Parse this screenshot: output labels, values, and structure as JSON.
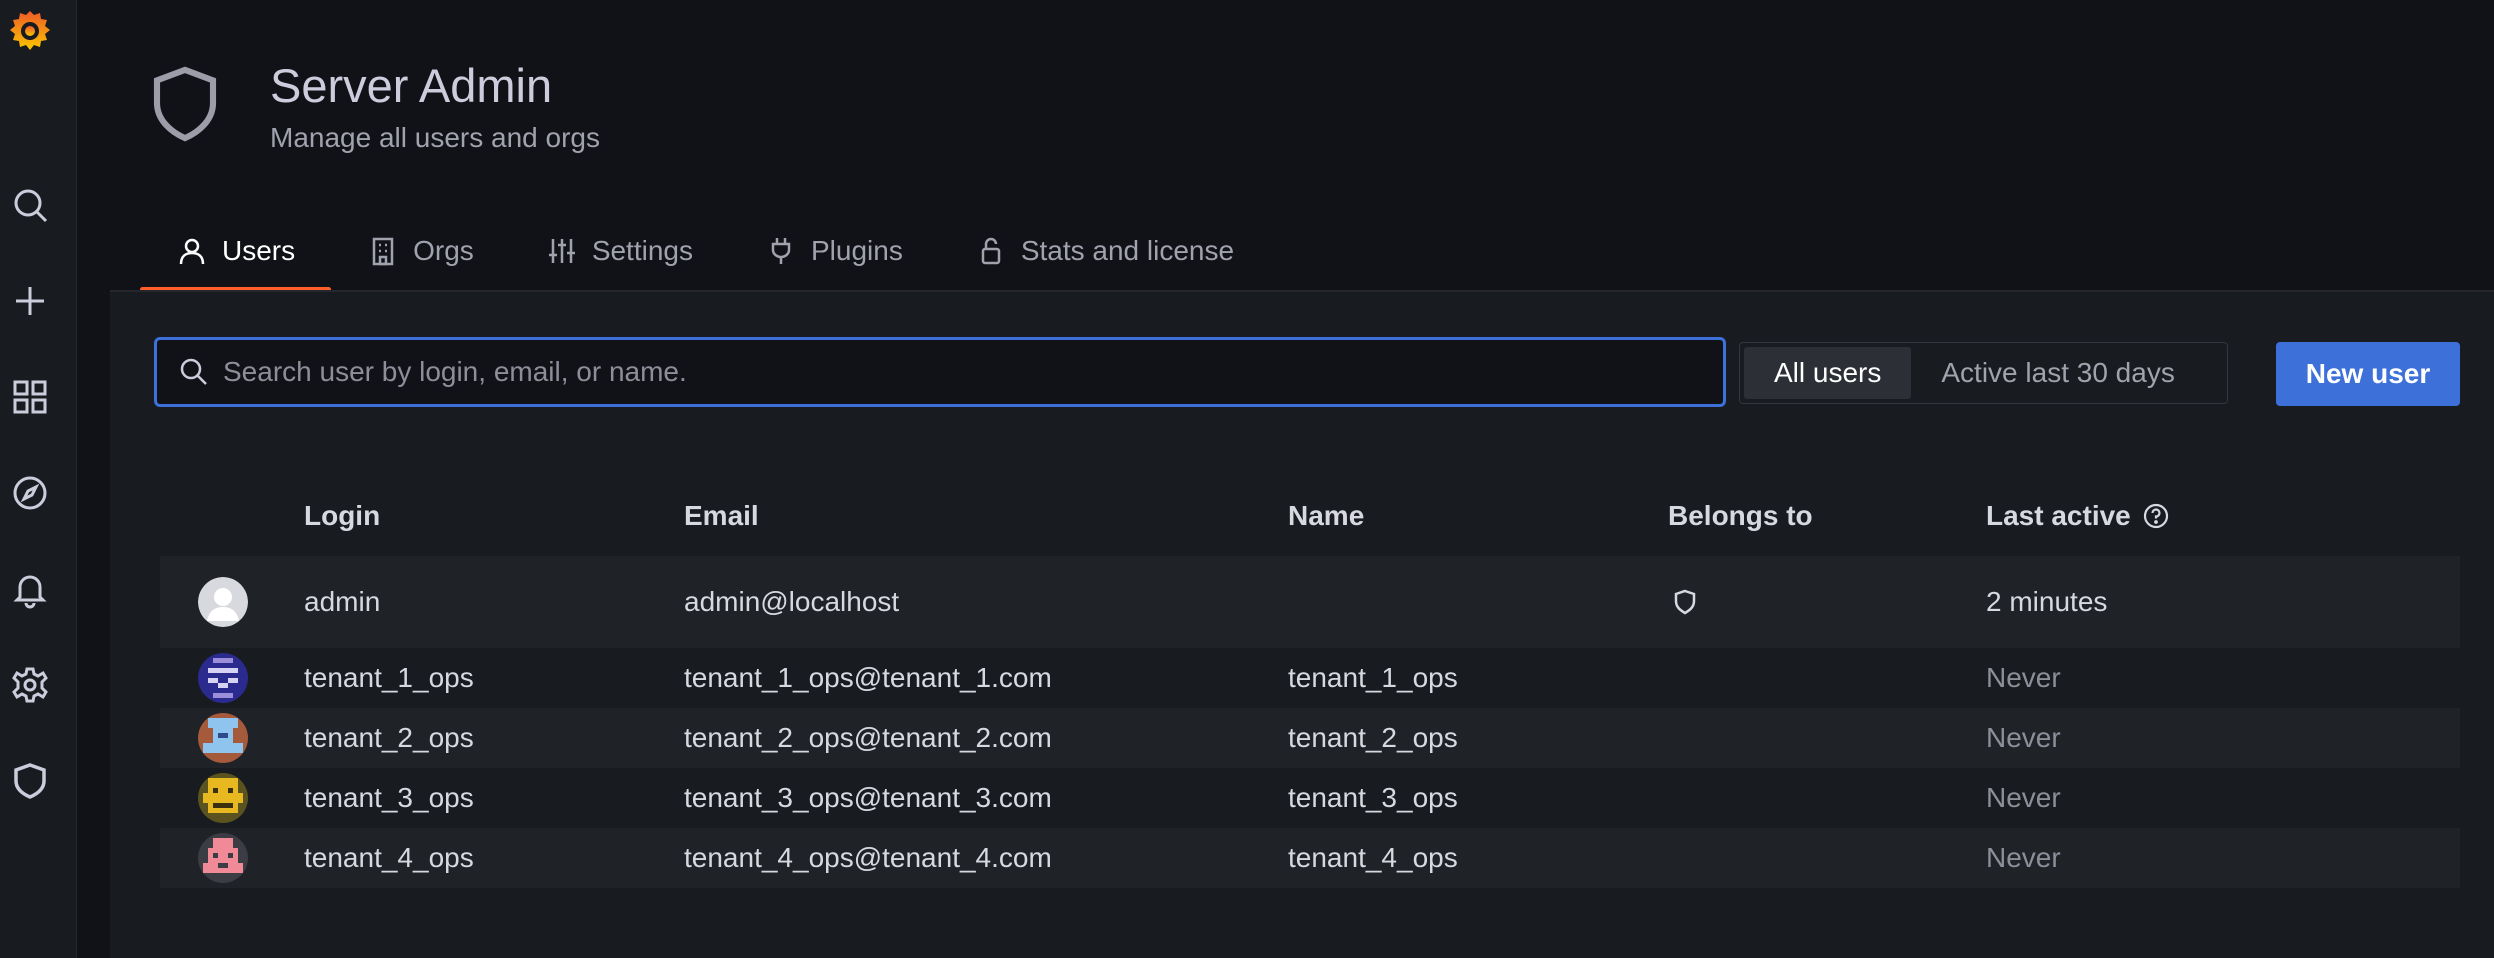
{
  "sidebar": {
    "items": [
      {
        "name": "search-icon"
      },
      {
        "name": "plus-icon"
      },
      {
        "name": "dashboards-icon"
      },
      {
        "name": "explore-compass-icon"
      },
      {
        "name": "bell-icon"
      },
      {
        "name": "gear-icon"
      },
      {
        "name": "shield-icon"
      }
    ]
  },
  "header": {
    "title": "Server Admin",
    "subtitle": "Manage all users and orgs"
  },
  "tabs": [
    {
      "label": "Users",
      "icon": "user-icon",
      "active": true
    },
    {
      "label": "Orgs",
      "icon": "building-icon",
      "active": false
    },
    {
      "label": "Settings",
      "icon": "sliders-icon",
      "active": false
    },
    {
      "label": "Plugins",
      "icon": "plug-icon",
      "active": false
    },
    {
      "label": "Stats and license",
      "icon": "lock-icon",
      "active": false
    }
  ],
  "search": {
    "placeholder": "Search user by login, email, or name.",
    "value": ""
  },
  "filter": {
    "options": [
      "All users",
      "Active last 30 days"
    ],
    "selected": "All users"
  },
  "new_user_label": "New user",
  "table": {
    "columns": [
      "Login",
      "Email",
      "Name",
      "Belongs to",
      "Last active"
    ],
    "rows": [
      {
        "login": "admin",
        "email": "admin@localhost",
        "name": "",
        "belongs_to_icon": "shield-icon",
        "last_active": "2 minutes"
      },
      {
        "login": "tenant_1_ops",
        "email": "tenant_1_ops@tenant_1.com",
        "name": "tenant_1_ops",
        "last_active": "Never"
      },
      {
        "login": "tenant_2_ops",
        "email": "tenant_2_ops@tenant_2.com",
        "name": "tenant_2_ops",
        "last_active": "Never"
      },
      {
        "login": "tenant_3_ops",
        "email": "tenant_3_ops@tenant_3.com",
        "name": "tenant_3_ops",
        "last_active": "Never"
      },
      {
        "login": "tenant_4_ops",
        "email": "tenant_4_ops@tenant_4.com",
        "name": "tenant_4_ops",
        "last_active": "Never"
      }
    ]
  },
  "colors": {
    "accent": "#3d71d9",
    "tab_underline": "#ff5f2b",
    "background": "#111217",
    "panel": "#181b1f"
  }
}
